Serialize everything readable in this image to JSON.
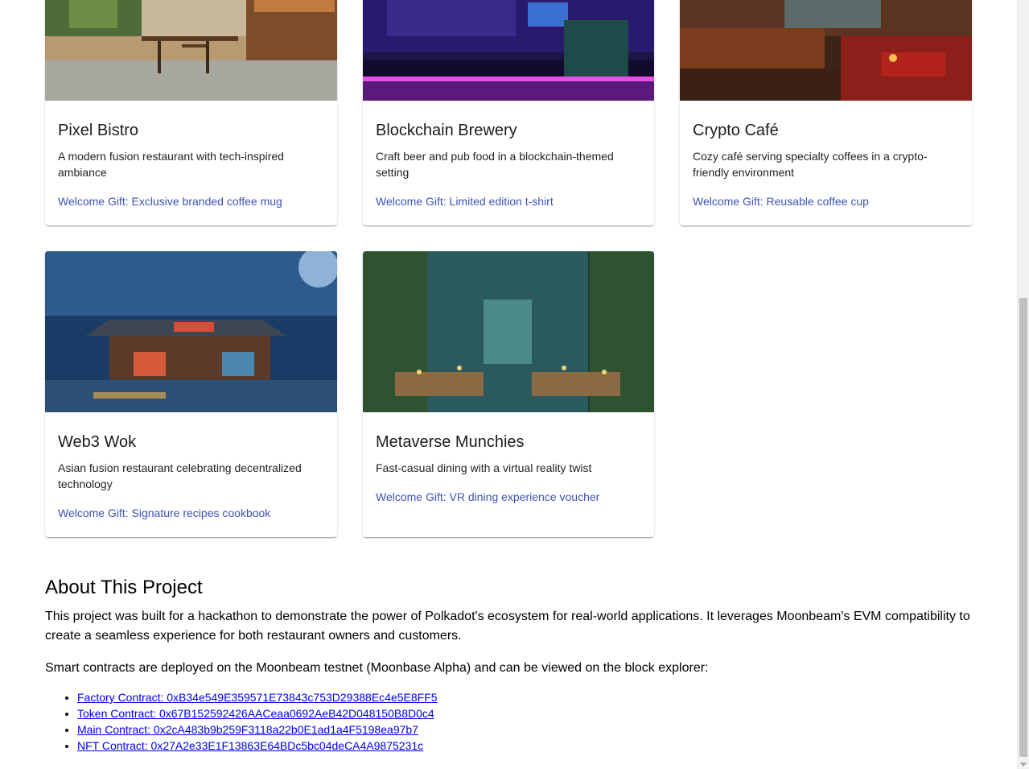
{
  "restaurants": [
    {
      "name": "Pixel Bistro",
      "description": "A modern fusion restaurant with tech-inspired ambiance",
      "gift": "Welcome Gift: Exclusive branded coffee mug"
    },
    {
      "name": "Blockchain Brewery",
      "description": "Craft beer and pub food in a blockchain-themed setting",
      "gift": "Welcome Gift: Limited edition t-shirt"
    },
    {
      "name": "Crypto Café",
      "description": "Cozy café serving specialty coffees in a crypto-friendly environment",
      "gift": "Welcome Gift: Reusable coffee cup"
    },
    {
      "name": "Web3 Wok",
      "description": "Asian fusion restaurant celebrating decentralized technology",
      "gift": "Welcome Gift: Signature recipes cookbook"
    },
    {
      "name": "Metaverse Munchies",
      "description": "Fast-casual dining with a virtual reality twist",
      "gift": "Welcome Gift: VR dining experience voucher"
    }
  ],
  "about": {
    "title": "About This Project",
    "paragraph1": "This project was built for a hackathon to demonstrate the power of Polkadot's ecosystem for real-world applications. It leverages Moonbeam's EVM compatibility to create a seamless experience for both restaurant owners and customers.",
    "paragraph2": "Smart contracts are deployed on the Moonbeam testnet (Moonbase Alpha) and can be viewed on the block explorer:",
    "links": [
      "Factory Contract: 0xB34e549E359571E73843c753D29388Ec4e5E8FF5",
      "Token Contract: 0x67B152592426AACeaa0692AeB42D048150B8D0c4",
      "Main Contract: 0x2cA483b9b259F3118a22b0E1ad1a4F5198ea97b7",
      "NFT Contract: 0x27A2e33E1F13863E64BDc5bc04deCA4A9875231c"
    ]
  }
}
